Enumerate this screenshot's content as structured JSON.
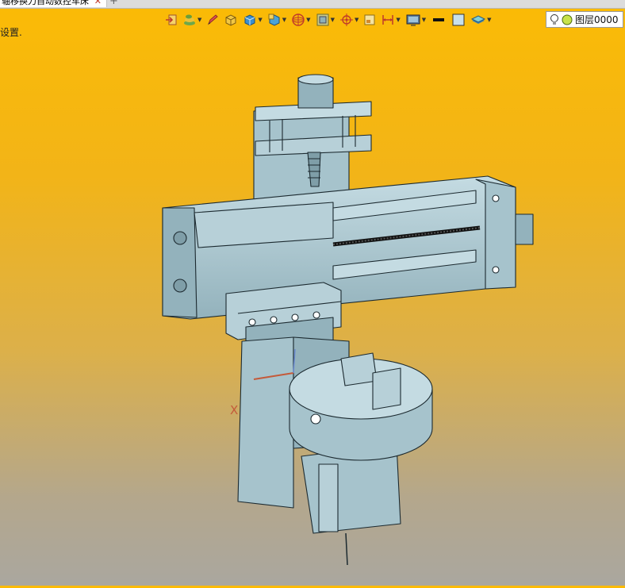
{
  "tab": {
    "title": "轴移换刀自动数控车床",
    "close": "✕",
    "add": "+"
  },
  "status": {
    "hint": "设置."
  },
  "toolbar": {
    "items": [
      {
        "icon": "exit-icon"
      },
      {
        "icon": "layers-stack-icon"
      },
      {
        "icon": "pencil-icon"
      },
      {
        "icon": "cube-yellow-icon"
      },
      {
        "icon": "cube-blue-icon"
      },
      {
        "icon": "cube-section-icon"
      },
      {
        "icon": "sphere-wire-icon"
      },
      {
        "icon": "view-frame-icon"
      },
      {
        "icon": "target-icon"
      },
      {
        "icon": "sheet-icon"
      },
      {
        "icon": "dimension-icon"
      },
      {
        "icon": "display-settings-icon"
      },
      {
        "icon": "line-color-icon"
      },
      {
        "icon": "fill-color-icon"
      },
      {
        "icon": "layer-icon"
      }
    ],
    "layer": {
      "label": "图层0000",
      "bulb": "lightbulb-icon",
      "dot": "layer-dot-icon"
    }
  },
  "viewport": {
    "axis_label": "X"
  },
  "colors": {
    "bg_top": "#fbbb05",
    "bg_bottom": "#aaa79f",
    "part_fill": "#a6c3cc",
    "part_fill_dark": "#7f9ea8",
    "part_fill_light": "#c4dbe2",
    "edge": "#1c2a30",
    "accent_red": "#c0392b",
    "layer_dot": "#c8e34a"
  }
}
